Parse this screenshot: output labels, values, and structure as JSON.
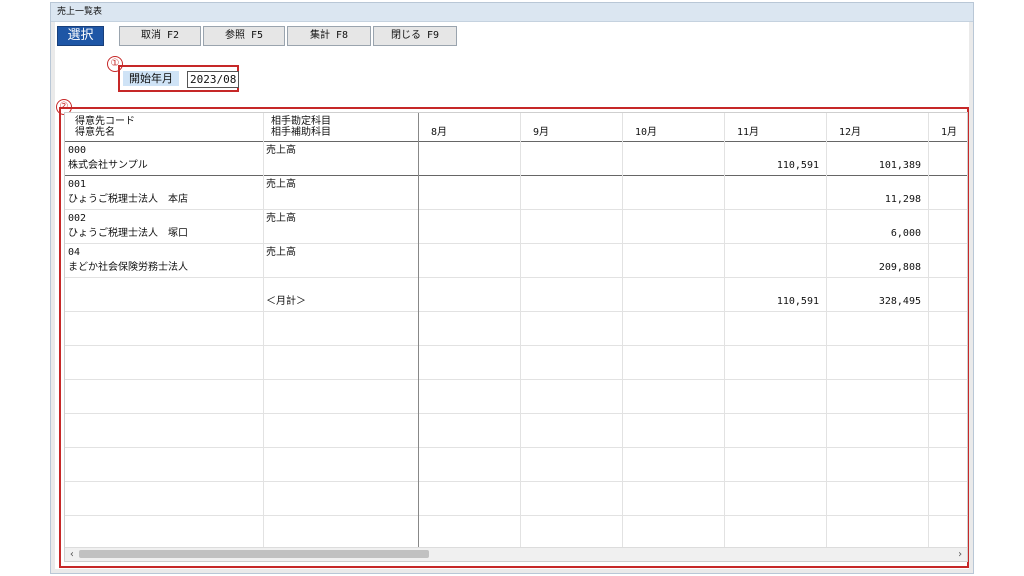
{
  "window": {
    "title": "売上一覧表"
  },
  "toolbar": {
    "select": "選択",
    "cancel": "取消 F2",
    "refer": "参照 F5",
    "aggregate": "集計 F8",
    "close": "閉じる F9"
  },
  "annotations": {
    "a1": "①",
    "a2": "②"
  },
  "filter": {
    "label": "開始年月",
    "value": "2023/08"
  },
  "table": {
    "headers": {
      "code": "得意先コード",
      "name": "得意先名",
      "account": "相手勘定科目",
      "subaccount": "相手補助科目",
      "months": [
        "8月",
        "9月",
        "10月",
        "11月",
        "12月",
        "1月"
      ]
    },
    "rows": [
      {
        "code": "000",
        "name": "株式会社サンプル",
        "account": "売上高",
        "values": [
          "",
          "",
          "",
          "110,591",
          "101,389",
          ""
        ]
      },
      {
        "code": "001",
        "name": "ひょうご税理士法人　本店",
        "account": "売上高",
        "values": [
          "",
          "",
          "",
          "",
          "11,298",
          ""
        ]
      },
      {
        "code": "002",
        "name": "ひょうご税理士法人　塚口",
        "account": "売上高",
        "values": [
          "",
          "",
          "",
          "",
          "6,000",
          ""
        ]
      },
      {
        "code": "04",
        "name": "まどか社会保険労務士法人",
        "account": "売上高",
        "values": [
          "",
          "",
          "",
          "",
          "209,808",
          ""
        ]
      }
    ],
    "total": {
      "label": "＜月計＞",
      "values": [
        "",
        "",
        "",
        "110,591",
        "328,495",
        ""
      ]
    }
  },
  "scroll": {
    "left": "‹",
    "right": "›"
  }
}
